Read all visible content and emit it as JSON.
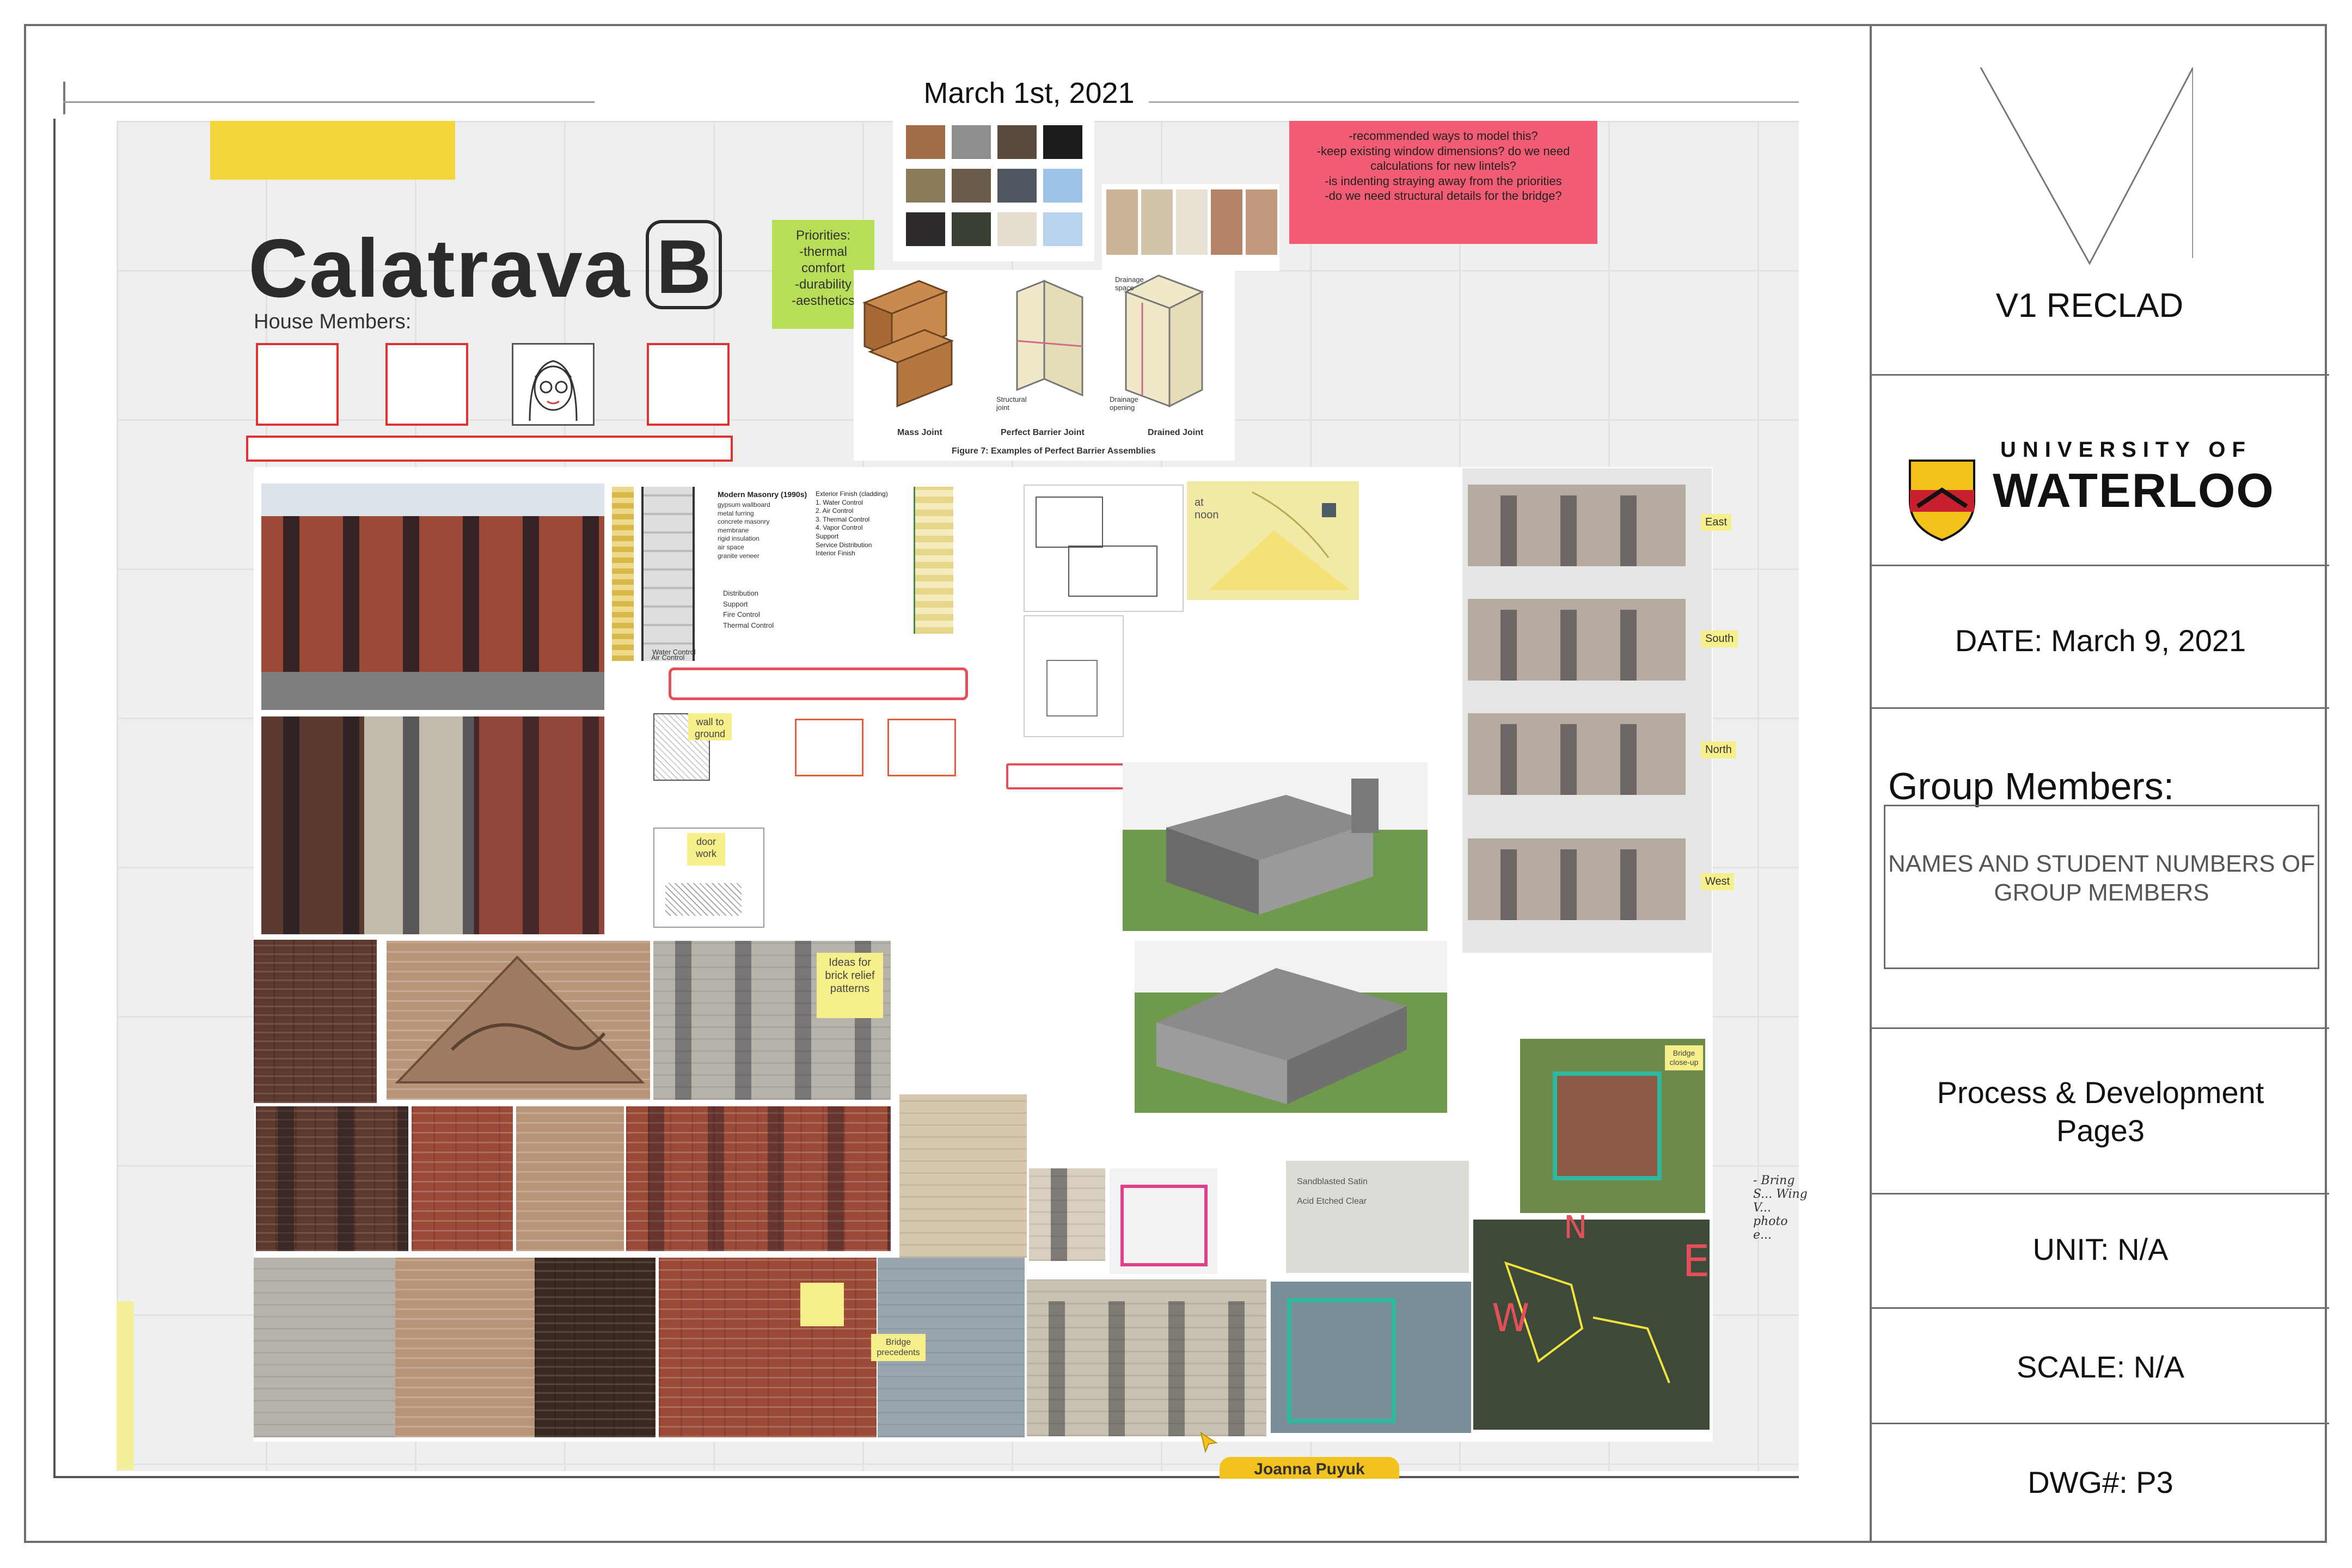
{
  "sheet": {
    "date_heading": "March 1st, 2021"
  },
  "board": {
    "team_name": "Calatrava",
    "team_letter": "B",
    "house_members_label": "House Members:",
    "priorities_note": "Priorities:\n-thermal comfort\n-durability\n-aesthetics",
    "questions_note": "-recommended ways to model this?\n-keep existing window dimensions? do we need calculations for new lintels?\n-is indenting straying away from the priorities\n-do we need structural details for the bridge?",
    "swatches": [
      "#a06d46",
      "#8e8e8e",
      "#5c4a40",
      "#1e1c1b",
      "#8a7a57",
      "#6a5a4a",
      "#4e5760",
      "#9cc2e6",
      "#2f2b2a",
      "#3a3f34",
      "#e4ddd0",
      "#b9d3ee"
    ],
    "strip_swatches": [
      "#cbb596",
      "#d3c3ab",
      "#e7e0d3",
      "#b48468",
      "#c19a7e"
    ],
    "joint_figure": {
      "caption": "Figure 7: Examples of Perfect Barrier Assemblies",
      "labels": [
        "Mass Joint",
        "Perfect Barrier Joint",
        "Drained Joint"
      ],
      "callouts": [
        "Structural joint",
        "Drainage space",
        "Drainage opening"
      ]
    },
    "wall_section": {
      "title": "Modern Masonry (1990s)",
      "layers": [
        "gypsum wallboard",
        "metal furring",
        "concrete masonry",
        "membrane",
        "rigid insulation",
        "air space",
        "granite veneer"
      ],
      "finish_title": "Exterior Finish (cladding)",
      "controls": [
        "1. Water Control",
        "2. Air Control",
        "3. Thermal Control",
        "4. Vapor Control"
      ],
      "support": [
        "Support",
        "Service Distribution",
        "Interior Finish"
      ],
      "left_labels": [
        "Distribution",
        "Support",
        "Fire Control",
        "Thermal Control",
        "Water Control",
        "Air Control"
      ]
    },
    "notes": {
      "wall_to_ground": "wall to ground",
      "door_work": "door work",
      "sun_noon": "at noon",
      "brick_relief": "Ideas for brick relief patterns",
      "bridge_closeup": "Bridge close-up",
      "bridge_precedents": "Bridge precedents",
      "glass_ideas": "Sandblasted  Satin\n\nAcid Etched   Clear"
    },
    "elevations": [
      "East",
      "South",
      "North",
      "West"
    ],
    "handwritten_note": "- Bring S... Wing V... photo e...",
    "map_letters": [
      "N",
      "E",
      "W"
    ],
    "name_tag": "Joanna Puyuk"
  },
  "title_block": {
    "project": "V1 RECLAD",
    "university_line1": "UNIVERSITY OF",
    "university_line2": "WATERLOO",
    "date": "DATE: March 9, 2021",
    "group_members_label": "Group Members:",
    "group_members_placeholder": "NAMES AND STUDENT NUMBERS OF GROUP MEMBERS",
    "stage": "Process & Development",
    "page": "Page3",
    "unit": "UNIT: N/A",
    "scale": "SCALE: N/A",
    "dwg": "DWG#: P3"
  },
  "colors": {
    "sticky_yellow": "#f4d63b",
    "sticky_green": "#b7de56",
    "sticky_pink": "#f15b73",
    "highlight_red": "#e3505a",
    "crest_gold": "#f2c21a",
    "crest_red": "#c8202f"
  }
}
